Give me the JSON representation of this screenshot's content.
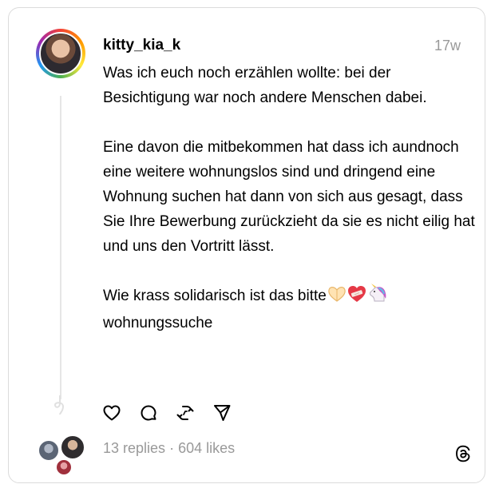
{
  "post": {
    "username": "kitty_kia_k",
    "time": "17w",
    "paragraph1": "Was ich euch noch erzählen wollte: bei der Besichtigung war noch andere Menschen dabei.",
    "paragraph2": "Eine davon die mitbekommen hat dass ich aundnoch eine weitere wohnungslos sind und dringend eine Wohnung suchen hat dann von sich aus gesagt, dass Sie Ihre Bewerbung zurückzieht da sie es nicht eilig hat und uns den Vortritt lässt.",
    "paragraph3_text": "Wie krass solidarisch ist das bitte",
    "paragraph3_emojis": [
      "heart-hands-emoji",
      "mending-heart-emoji",
      "unicorn-emoji"
    ],
    "hashtag": "wohnungssuche"
  },
  "actions": [
    "like-icon",
    "reply-icon",
    "repost-icon",
    "share-icon"
  ],
  "stats": {
    "replies": "13 replies",
    "separator": "·",
    "likes": "604 likes"
  },
  "colors": {
    "text": "#000000",
    "muted": "#999999",
    "border": "#dbdbdb",
    "thread_line": "#e6e6e6"
  }
}
